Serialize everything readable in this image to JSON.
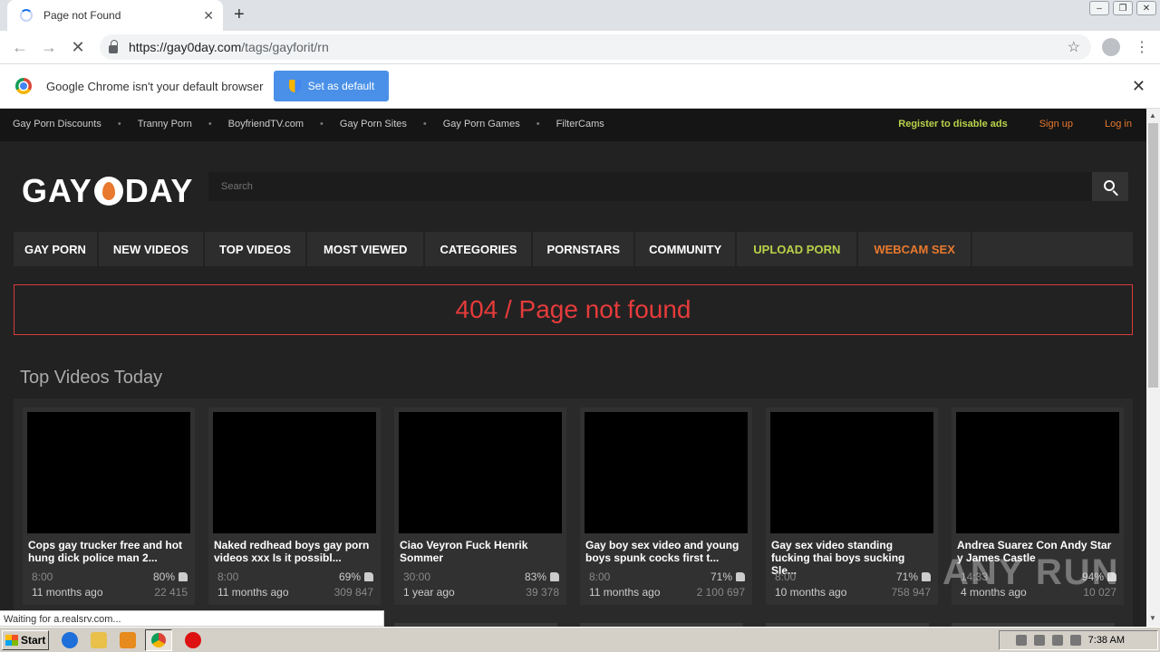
{
  "browser": {
    "tab_title": "Page not Found",
    "url_host": "https://gay0day.com",
    "url_path": "/tags/gayforit/rn",
    "infobar_text": "Google Chrome isn't your default browser",
    "set_default_label": "Set as default",
    "status_text": "Waiting for a.realsrv.com..."
  },
  "site": {
    "top_links": [
      "Gay Porn Discounts",
      "Tranny Porn",
      "BoyfriendTV.com",
      "Gay Porn Sites",
      "Gay Porn Games",
      "FilterCams"
    ],
    "register": "Register to disable ads",
    "signup": "Sign up",
    "login": "Log in",
    "logo_left": "GAY",
    "logo_right": "DAY",
    "search_placeholder": "Search",
    "nav": [
      "GAY PORN",
      "NEW VIDEOS",
      "TOP VIDEOS",
      "MOST VIEWED",
      "CATEGORIES",
      "PORNSTARS",
      "COMMUNITY",
      "UPLOAD PORN",
      "WEBCAM SEX"
    ],
    "error_text": "404 / Page not found",
    "section_title": "Top Videos Today",
    "videos": [
      {
        "title": "Cops gay trucker free and hot hung dick police man 2...",
        "duration": "8:00",
        "rating": "80%",
        "age": "11 months ago",
        "views": "22 415"
      },
      {
        "title": "Naked redhead boys gay porn videos xxx Is it possibl...",
        "duration": "8:00",
        "rating": "69%",
        "age": "11 months ago",
        "views": "309 847"
      },
      {
        "title": "Ciao Veyron Fuck Henrik Sommer",
        "duration": "30:00",
        "rating": "83%",
        "age": "1 year ago",
        "views": "39 378"
      },
      {
        "title": "Gay boy sex video and young boys spunk cocks first t...",
        "duration": "8:00",
        "rating": "71%",
        "age": "11 months ago",
        "views": "2 100 697"
      },
      {
        "title": "Gay sex video standing fucking thai boys sucking Sle...",
        "duration": "8:00",
        "rating": "71%",
        "age": "10 months ago",
        "views": "758 947"
      },
      {
        "title": "Andrea Suarez Con Andy Star y James Castle",
        "duration": "14:33",
        "rating": "94%",
        "age": "4 months ago",
        "views": "10 027"
      }
    ],
    "watermark": "ANY RUN"
  },
  "taskbar": {
    "start_label": "Start",
    "clock": "7:38 AM"
  },
  "colors": {
    "accent_green": "#b9d24a",
    "accent_orange": "#e8792e",
    "error_red": "#e63b3b"
  }
}
